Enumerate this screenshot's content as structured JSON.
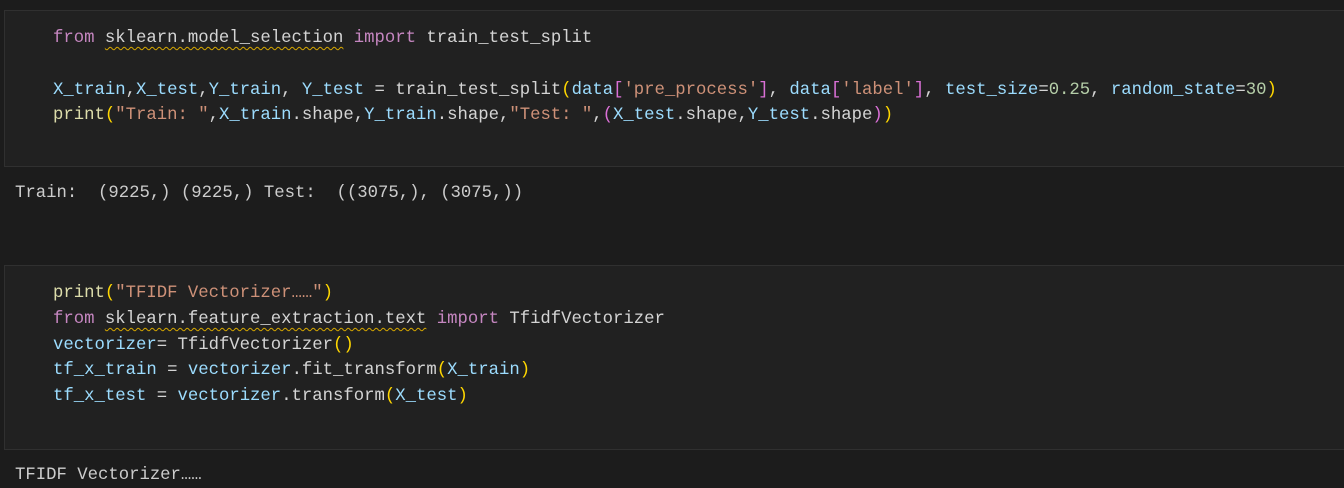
{
  "cells": [
    {
      "lines": [
        [
          [
            "kw",
            "from"
          ],
          [
            "pl",
            " "
          ],
          [
            "mod",
            "sklearn.model_selection"
          ],
          [
            "pl",
            " "
          ],
          [
            "kw",
            "import"
          ],
          [
            "pl",
            " train_test_split"
          ]
        ],
        [],
        [
          [
            "var",
            "X_train"
          ],
          [
            "pl",
            ","
          ],
          [
            "var",
            "X_test"
          ],
          [
            "pl",
            ","
          ],
          [
            "var",
            "Y_train"
          ],
          [
            "pl",
            ", "
          ],
          [
            "var",
            "Y_test"
          ],
          [
            "pl",
            " = train_test_split"
          ],
          [
            "b1",
            "("
          ],
          [
            "var",
            "data"
          ],
          [
            "b2",
            "["
          ],
          [
            "str",
            "'pre_process'"
          ],
          [
            "b2",
            "]"
          ],
          [
            "pl",
            ", "
          ],
          [
            "var",
            "data"
          ],
          [
            "b2",
            "["
          ],
          [
            "str",
            "'label'"
          ],
          [
            "b2",
            "]"
          ],
          [
            "pl",
            ", "
          ],
          [
            "var",
            "test_size"
          ],
          [
            "pl",
            "="
          ],
          [
            "num",
            "0.25"
          ],
          [
            "pl",
            ", "
          ],
          [
            "var",
            "random_state"
          ],
          [
            "pl",
            "="
          ],
          [
            "num",
            "30"
          ],
          [
            "b1",
            ")"
          ]
        ],
        [
          [
            "fn",
            "print"
          ],
          [
            "b1",
            "("
          ],
          [
            "str",
            "\"Train: \""
          ],
          [
            "pl",
            ","
          ],
          [
            "var",
            "X_train"
          ],
          [
            "pl",
            ".shape,"
          ],
          [
            "var",
            "Y_train"
          ],
          [
            "pl",
            ".shape,"
          ],
          [
            "str",
            "\"Test: \""
          ],
          [
            "pl",
            ","
          ],
          [
            "b2",
            "("
          ],
          [
            "var",
            "X_test"
          ],
          [
            "pl",
            ".shape,"
          ],
          [
            "var",
            "Y_test"
          ],
          [
            "pl",
            ".shape"
          ],
          [
            "b2",
            ")"
          ],
          [
            "b1",
            ")"
          ]
        ]
      ],
      "output": "Train:  (9225,) (9225,) Test:  ((3075,), (3075,))"
    },
    {
      "lines": [
        [
          [
            "fn",
            "print"
          ],
          [
            "b1",
            "("
          ],
          [
            "str",
            "\"TFIDF Vectorizer……\""
          ],
          [
            "b1",
            ")"
          ]
        ],
        [
          [
            "kw",
            "from"
          ],
          [
            "pl",
            " "
          ],
          [
            "mod",
            "sklearn.feature_extraction.text"
          ],
          [
            "pl",
            " "
          ],
          [
            "kw",
            "import"
          ],
          [
            "pl",
            " TfidfVectorizer"
          ]
        ],
        [
          [
            "var",
            "vectorizer"
          ],
          [
            "pl",
            "= TfidfVectorizer"
          ],
          [
            "b1",
            "()"
          ]
        ],
        [
          [
            "var",
            "tf_x_train"
          ],
          [
            "pl",
            " = "
          ],
          [
            "var",
            "vectorizer"
          ],
          [
            "pl",
            ".fit_transform"
          ],
          [
            "b1",
            "("
          ],
          [
            "var",
            "X_train"
          ],
          [
            "b1",
            ")"
          ]
        ],
        [
          [
            "var",
            "tf_x_test"
          ],
          [
            "pl",
            " = "
          ],
          [
            "var",
            "vectorizer"
          ],
          [
            "pl",
            ".transform"
          ],
          [
            "b1",
            "("
          ],
          [
            "var",
            "X_test"
          ],
          [
            "b1",
            ")"
          ]
        ]
      ],
      "output": "TFIDF Vectorizer……"
    }
  ]
}
